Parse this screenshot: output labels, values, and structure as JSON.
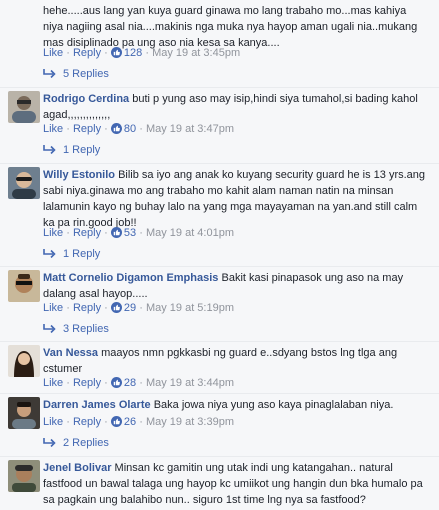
{
  "comments": [
    {
      "author": "",
      "text": "hehe.....aus lang yan kuya guard ginawa mo lang trabaho mo...mas kahiya niya nagiing asal nia....makinis nga muka nya hayop aman ugali nia..mukang mas disiplinado pa ung aso nia kesa sa kanya....",
      "like_label": "Like",
      "reply_label": "Reply",
      "likes": "128",
      "time": "May 19 at 3:45pm",
      "replies_label": "5 Replies"
    },
    {
      "author": "Rodrigo Cerdina",
      "text": "buti p yung aso may isip,hindi siya tumahol,si bading kahol agad,,,,,,,,,,,,,,",
      "like_label": "Like",
      "reply_label": "Reply",
      "likes": "80",
      "time": "May 19 at 3:47pm",
      "replies_label": "1 Reply"
    },
    {
      "author": "Willy Estonilo",
      "text": "Bilib sa iyo ang anak ko kuyang security guard he is 13 yrs.ang sabi niya.ginawa mo ang trabaho mo kahit alam naman natin na minsan lalamunin kayo ng buhay lalo na yang mga mayayaman na yan.and still calm ka pa rin.good job!!",
      "like_label": "Like",
      "reply_label": "Reply",
      "likes": "53",
      "time": "May 19 at 4:01pm",
      "replies_label": "1 Reply"
    },
    {
      "author": "Matt Cornelio Digamon Emphasis",
      "text": "Bakit kasi pinapasok ung aso na may dalang asal hayop.....",
      "like_label": "Like",
      "reply_label": "Reply",
      "likes": "29",
      "time": "May 19 at 5:19pm",
      "replies_label": "3 Replies"
    },
    {
      "author": "Van Nessa",
      "text": "maayos nmn pgkkasbi ng guard e..sdyang bstos lng tlga ang cstumer",
      "like_label": "Like",
      "reply_label": "Reply",
      "likes": "28",
      "time": "May 19 at 3:44pm",
      "replies_label": ""
    },
    {
      "author": "Darren James Olarte",
      "text": "Baka jowa niya yung aso kaya pinaglalaban niya.",
      "like_label": "Like",
      "reply_label": "Reply",
      "likes": "26",
      "time": "May 19 at 3:39pm",
      "replies_label": "2 Replies"
    },
    {
      "author": "Jenel Bolivar",
      "text": "Minsan kc gamitin ung utak indi ung katangahan.. natural fastfood un bawal talaga ung hayop kc umiikot ung hangin dun bka humalo pa sa pagkain ung balahibo nun.. siguro 1st time lng nya sa fastfood?",
      "like_label": "",
      "reply_label": "",
      "likes": "",
      "time": "",
      "replies_label": ""
    }
  ],
  "colors": {
    "author": "#365899",
    "link": "#4267b2",
    "meta": "#90949c",
    "background": "#f6f7f9"
  },
  "icons": {
    "like": "thumbs-up-icon",
    "reply": "reply-arrow-icon"
  }
}
